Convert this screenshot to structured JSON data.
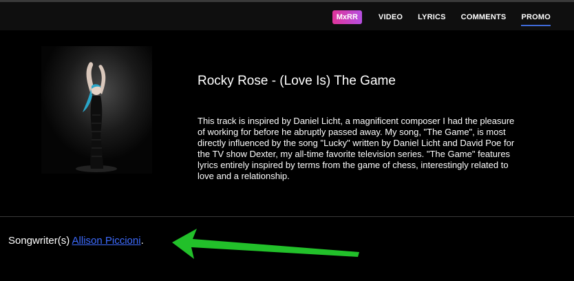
{
  "nav": {
    "brand": "MxRR",
    "links": [
      "VIDEO",
      "LYRICS",
      "COMMENTS",
      "PROMO"
    ],
    "active": "PROMO"
  },
  "track": {
    "title": "Rocky Rose - (Love Is) The Game",
    "description": "This track is inspired by Daniel Licht, a magnificent composer I had the pleasure of working for before he abruptly passed away. My song, \"The Game\", is most directly influenced by the song \"Lucky\" written by Daniel Licht and David Poe for the TV show Dexter, my all-time favorite television series. \"The Game\" features lyrics entirely inspired by terms from the game of chess, interestingly related to love and a relationship."
  },
  "songwriter": {
    "label": "Songwriter(s)",
    "name": "Allison Piccioni",
    "suffix": "."
  },
  "colors": {
    "background": "#000000",
    "navbar": "#0f0f0f",
    "link": "#3d6bff",
    "active_underline": "#3f6ad8",
    "arrow": "#22c02a"
  }
}
